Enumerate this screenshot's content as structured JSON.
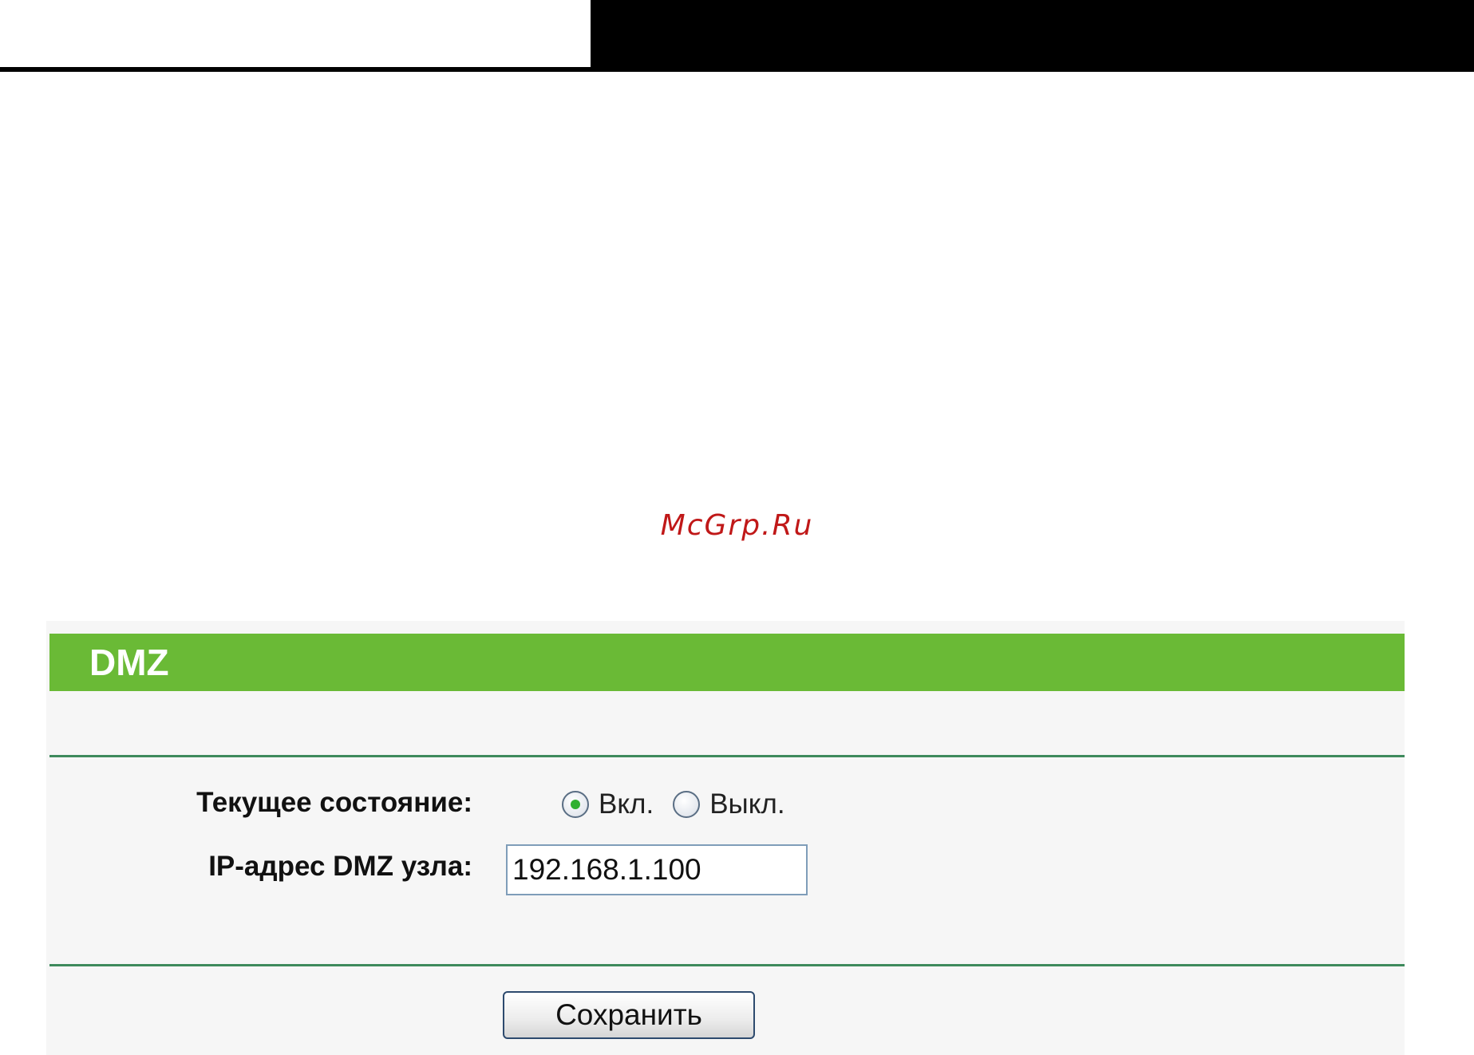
{
  "watermark": "McGrp.Ru",
  "panel": {
    "title": "DMZ",
    "status_label": "Текущее состояние:",
    "status_options": [
      {
        "label": "Вкл.",
        "selected": true
      },
      {
        "label": "Выкл.",
        "selected": false
      }
    ],
    "ip_label": "IP-адрес DMZ узла:",
    "ip_value": "192.168.1.100",
    "save_label": "Сохранить"
  },
  "colors": {
    "header_green": "#6aba36",
    "divider_green": "#3e8a5c",
    "watermark_red": "#c01818"
  }
}
